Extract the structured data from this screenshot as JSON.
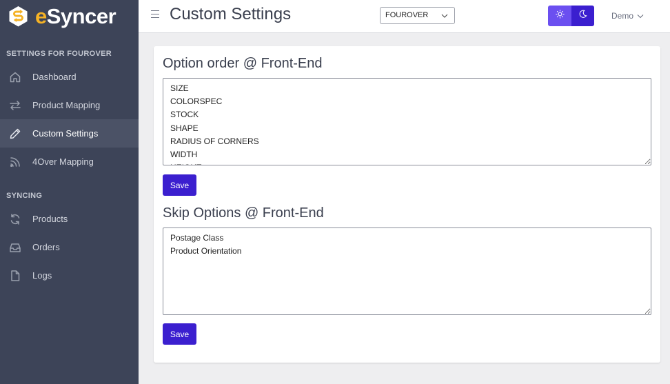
{
  "app": {
    "brand_e": "e",
    "brand_rest": "Syncer",
    "brand_color": "#f5b225"
  },
  "sidebar": {
    "section1_title": "SETTINGS FOR FOUROVER",
    "section2_title": "SYNCING",
    "items": [
      {
        "label": "Dashboard",
        "icon": "home-icon"
      },
      {
        "label": "Product Mapping",
        "icon": "arrows-exchange-icon"
      },
      {
        "label": "Custom Settings",
        "icon": "pencil-icon",
        "active": true
      },
      {
        "label": "4Over Mapping",
        "icon": "rss-icon"
      },
      {
        "label": "Products",
        "icon": "sync-icon"
      },
      {
        "label": "Orders",
        "icon": "inbox-icon"
      },
      {
        "label": "Logs",
        "icon": "document-icon"
      }
    ]
  },
  "header": {
    "title": "Custom Settings",
    "store_selected": "FOUROVER",
    "user_name": "Demo",
    "accent": "#3b1fcf"
  },
  "main": {
    "option_order": {
      "heading": "Option order @ Front-End",
      "value": "SIZE\nCOLORSPEC\nSTOCK\nSHAPE\nRADIUS OF CORNERS\nWIDTH\nHEIGHT",
      "save_label": "Save"
    },
    "skip_options": {
      "heading": "Skip Options @ Front-End",
      "value": "Postage Class\nProduct Orientation",
      "save_label": "Save"
    }
  }
}
